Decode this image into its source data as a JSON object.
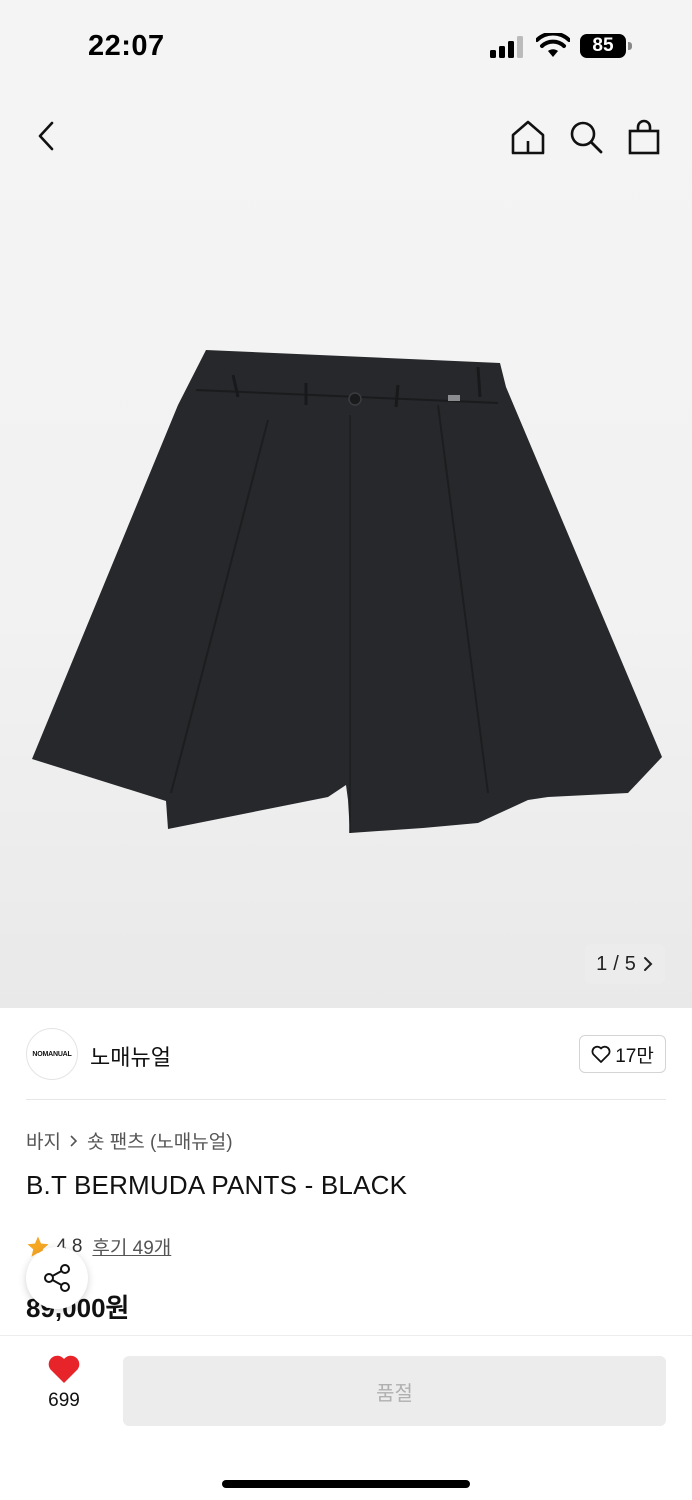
{
  "status_bar": {
    "time": "22:07",
    "battery": "85"
  },
  "gallery": {
    "current": "1",
    "separator": "/",
    "total": "5"
  },
  "brand": {
    "logo_text": "NOMANUAL",
    "name": "노매뉴얼",
    "likes": "17만"
  },
  "breadcrumb": {
    "category": "바지",
    "subcategory": "숏 팬츠 (노매뉴얼)"
  },
  "product": {
    "title": "B.T BERMUDA PANTS - BLACK",
    "rating": "4.8",
    "reviews": "후기 49개",
    "price": "89,000원"
  },
  "bottom": {
    "wish_count": "699",
    "buy_label": "품절"
  },
  "colors": {
    "heart": "#e8242b",
    "star": "#f5a623",
    "pants": "#26282b"
  }
}
